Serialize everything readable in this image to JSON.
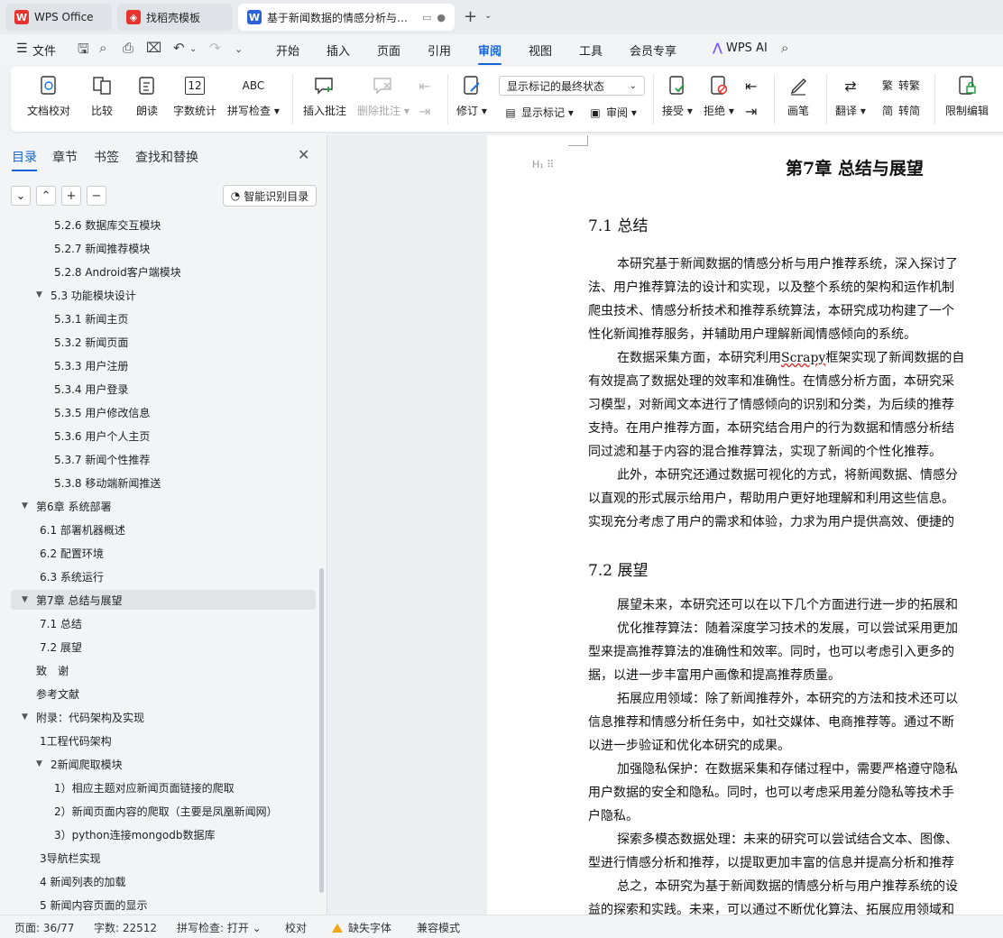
{
  "tabs": [
    {
      "label": "WPS Office"
    },
    {
      "label": "找稻壳模板"
    },
    {
      "label": "基于新闻数据的情感分析与用户推荐系统"
    }
  ],
  "menu": {
    "file": "文件",
    "items": [
      "开始",
      "插入",
      "页面",
      "引用",
      "审阅",
      "视图",
      "工具",
      "会员专享"
    ],
    "active": "审阅",
    "wps_ai": "WPS AI"
  },
  "ribbon": {
    "doc_check": "文档校对",
    "compare": "比较",
    "read_aloud": "朗读",
    "word_count": "字数统计",
    "spell_check": "拼写检查",
    "insert_comment": "插入批注",
    "delete_comment": "删除批注",
    "revise": "修订",
    "markup_select": "显示标记的最终状态",
    "show_markup": "显示标记",
    "review": "审阅",
    "accept": "接受",
    "reject": "拒绝",
    "pen": "画笔",
    "translate": "翻译",
    "to_traditional": "转繁",
    "to_simplified": "转简",
    "restrict_edit": "限制编辑",
    "abc": "ABC",
    "count_icon": "12"
  },
  "left_panel": {
    "tabs": [
      "目录",
      "章节",
      "书签",
      "查找和替换"
    ],
    "smart_toc": "智能识别目录",
    "toc": [
      {
        "label": "5.2.6 数据库交互模块",
        "level": 3,
        "caret": ""
      },
      {
        "label": "5.2.7 新闻推荐模块",
        "level": 3,
        "caret": ""
      },
      {
        "label": "5.2.8 Android客户端模块",
        "level": 3,
        "caret": ""
      },
      {
        "label": "5.3 功能模块设计",
        "level": 2,
        "caret": "▼"
      },
      {
        "label": "5.3.1 新闻主页",
        "level": 3,
        "caret": ""
      },
      {
        "label": "5.3.2 新闻页面",
        "level": 3,
        "caret": ""
      },
      {
        "label": "5.3.3 用户注册",
        "level": 3,
        "caret": ""
      },
      {
        "label": "5.3.4 用户登录",
        "level": 3,
        "caret": ""
      },
      {
        "label": "5.3.5 用户修改信息",
        "level": 3,
        "caret": ""
      },
      {
        "label": "5.3.6 用户个人主页",
        "level": 3,
        "caret": ""
      },
      {
        "label": "5.3.7 新闻个性推荐",
        "level": 3,
        "caret": ""
      },
      {
        "label": "5.3.8 移动端新闻推送",
        "level": 3,
        "caret": ""
      },
      {
        "label": "第6章 系统部署",
        "level": 1,
        "caret": "▼"
      },
      {
        "label": "6.1 部署机器概述",
        "level": 2,
        "caret": ""
      },
      {
        "label": "6.2 配置环境",
        "level": 2,
        "caret": ""
      },
      {
        "label": "6.3 系统运行",
        "level": 2,
        "caret": ""
      },
      {
        "label": "第7章 总结与展望",
        "level": 1,
        "caret": "▼",
        "selected": true
      },
      {
        "label": "7.1 总结",
        "level": 2,
        "caret": ""
      },
      {
        "label": "7.2 展望",
        "level": 2,
        "caret": ""
      },
      {
        "label": "致　谢",
        "level": 1,
        "caret": " "
      },
      {
        "label": "参考文献",
        "level": 1,
        "caret": " "
      },
      {
        "label": "附录：代码架构及实现",
        "level": 1,
        "caret": "▼"
      },
      {
        "label": "1工程代码架构",
        "level": 2,
        "caret": ""
      },
      {
        "label": "2新闻爬取模块",
        "level": 2,
        "caret": "▼"
      },
      {
        "label": "1）相应主题对应新闻页面链接的爬取",
        "level": 3,
        "caret": ""
      },
      {
        "label": "2）新闻页面内容的爬取（主要是凤凰新闻网）",
        "level": 3,
        "caret": ""
      },
      {
        "label": "3）python连接mongodb数据库",
        "level": 3,
        "caret": ""
      },
      {
        "label": "3导航栏实现",
        "level": 2,
        "caret": ""
      },
      {
        "label": "4 新闻列表的加载",
        "level": 2,
        "caret": ""
      },
      {
        "label": "5 新闻内容页面的显示",
        "level": 2,
        "caret": ""
      }
    ]
  },
  "document": {
    "heading_marker": "H₁",
    "title": "第7章 总结与展望",
    "s71": "7.1 总结",
    "p1": [
      "本研究基于新闻数据的情感分析与用户推荐系统，深入探讨了",
      "法、用户推荐算法的设计和实现，以及整个系统的架构和运作机制",
      "爬虫技术、情感分析技术和推荐系统算法，本研究成功构建了一个",
      "性化新闻推荐服务，并辅助用户理解新闻情感倾向的系统。"
    ],
    "p2_pre": "在数据采集方面，本研究利用",
    "p2_scrapy": "Scrapy",
    "p2_post": "框架实现了新闻数据的自",
    "p2": [
      "有效提高了数据处理的效率和准确性。在情感分析方面，本研究采",
      "习模型，对新闻文本进行了情感倾向的识别和分类，为后续的推荐",
      "支持。在用户推荐方面，本研究结合用户的行为数据和情感分析结",
      "同过滤和基于内容的混合推荐算法，实现了新闻的个性化推荐。"
    ],
    "p3": [
      "此外，本研究还通过数据可视化的方式，将新闻数据、情感分",
      "以直观的形式展示给用户，帮助用户更好地理解和利用这些信息。",
      "实现充分考虑了用户的需求和体验，力求为用户提供高效、便捷的"
    ],
    "s72": "7.2 展望",
    "p4": [
      "展望未来，本研究还可以在以下几个方面进行进一步的拓展和"
    ],
    "p5": [
      "优化推荐算法：随着深度学习技术的发展，可以尝试采用更加",
      "型来提高推荐算法的准确性和效率。同时，也可以考虑引入更多的",
      "据，以进一步丰富用户画像和提高推荐质量。"
    ],
    "p6": [
      "拓展应用领域：除了新闻推荐外，本研究的方法和技术还可以",
      "信息推荐和情感分析任务中，如社交媒体、电商推荐等。通过不断",
      "以进一步验证和优化本研究的成果。"
    ],
    "p7": [
      "加强隐私保护：在数据采集和存储过程中，需要严格遵守隐私",
      "用户数据的安全和隐私。同时，也可以考虑采用差分隐私等技术手",
      "户隐私。"
    ],
    "p8": [
      "探索多模态数据处理：未来的研究可以尝试结合文本、图像、",
      "型进行情感分析和推荐，以提取更加丰富的信息并提高分析和推荐"
    ],
    "p9": [
      "总之，本研究为基于新闻数据的情感分析与用户推荐系统的设",
      "益的探索和实践。未来，可以通过不断优化算法、拓展应用领域和"
    ]
  },
  "status": {
    "page": "页面: 36/77",
    "words": "字数: 22512",
    "spell": "拼写检查: 打开",
    "proof": "校对",
    "missing_font": "缺失字体",
    "compat": "兼容模式"
  }
}
